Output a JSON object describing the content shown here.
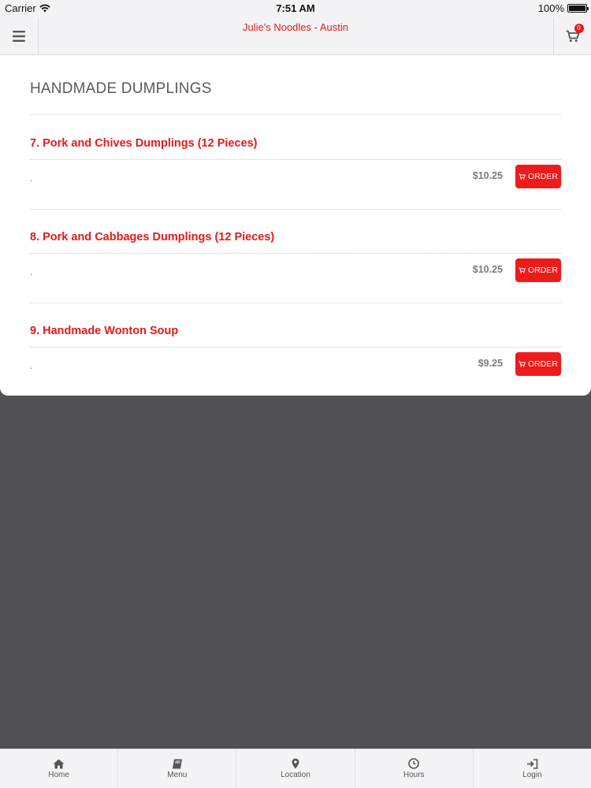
{
  "status_bar": {
    "carrier": "Carrier",
    "time": "7:51 AM",
    "battery": "100%"
  },
  "header": {
    "title": "Julie's Noodles - Austin",
    "cart_count": "0"
  },
  "section": {
    "title": "HANDMADE DUMPLINGS",
    "items": [
      {
        "name": "7. Pork and Chives Dumplings (12 Pieces)",
        "description": ".",
        "price": "$10.25",
        "order_label": "ORDER"
      },
      {
        "name": "8. Pork and Cabbages Dumplings (12 Pieces)",
        "description": ".",
        "price": "$10.25",
        "order_label": "ORDER"
      },
      {
        "name": "9. Handmade Wonton Soup",
        "description": ".",
        "price": "$9.25",
        "order_label": "ORDER"
      }
    ]
  },
  "tabs": [
    {
      "label": "Home",
      "icon": "home-icon"
    },
    {
      "label": "Menu",
      "icon": "book-icon"
    },
    {
      "label": "Location",
      "icon": "map-pin-icon"
    },
    {
      "label": "Hours",
      "icon": "clock-icon"
    },
    {
      "label": "Login",
      "icon": "sign-in-icon"
    }
  ],
  "colors": {
    "accent": "#e01b1b",
    "order_button": "#ef1a1a",
    "background": "#515053"
  }
}
